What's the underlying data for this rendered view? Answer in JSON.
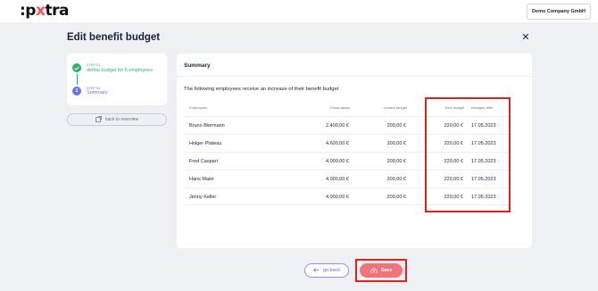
{
  "header": {
    "logo_prefix": ":p",
    "logo_x": "x",
    "logo_suffix": "tra",
    "company": "Demo Company GmbH"
  },
  "page": {
    "title": "Edit benefit budget",
    "close_symbol": "✕"
  },
  "steps": [
    {
      "small": "STEP 01",
      "label": "define budget for 5 employees",
      "status": "done"
    },
    {
      "small": "STEP 02",
      "label": "Summary",
      "number": "2",
      "status": "current"
    }
  ],
  "back_to_overview": "back to overview",
  "summary": {
    "title": "Summary",
    "intro": "The following employees receive an increase of their benefit budget",
    "columns": {
      "employees": "Employees",
      "gross": "Gross salary",
      "current": "current budget",
      "new": "New budget",
      "changed": "changed after"
    },
    "rows": [
      {
        "name": "Bruno Biermann",
        "gross": "2.400,00 €",
        "current": "200,00 €",
        "new": "220,00 €",
        "date": "17.05.2023"
      },
      {
        "name": "Holger Plateau",
        "gross": "4.600,00 €",
        "current": "200,00 €",
        "new": "220,00 €",
        "date": "17.05.2023"
      },
      {
        "name": "Fred Caspari",
        "gross": "4.000,00 €",
        "current": "200,00 €",
        "new": "220,00 €",
        "date": "17.05.2023"
      },
      {
        "name": "Hans Maier",
        "gross": "4.000,00 €",
        "current": "200,00 €",
        "new": "220,00 €",
        "date": "17.05.2023"
      },
      {
        "name": "Jenny Keller",
        "gross": "4.000,00 €",
        "current": "200,00 €",
        "new": "220,00 €",
        "date": "17.05.2023"
      }
    ]
  },
  "footer": {
    "go_back": "go back",
    "save": "Save"
  },
  "colors": {
    "accent": "#6a72e0",
    "success": "#2ab36b",
    "save": "#f3737c",
    "highlight": "#e3201b"
  }
}
